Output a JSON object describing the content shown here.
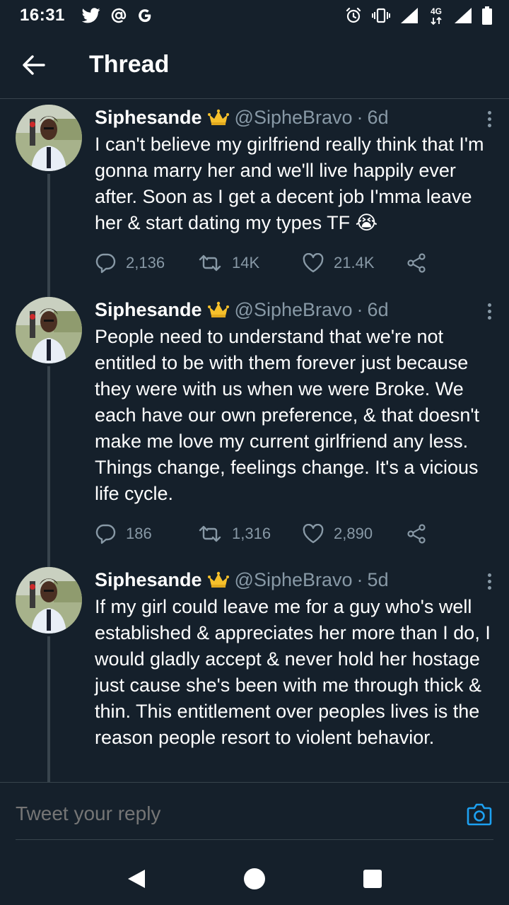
{
  "status_bar": {
    "time": "16:31",
    "left_icons": [
      "twitter-icon",
      "at-icon",
      "google-icon"
    ],
    "right_icons": [
      "alarm-icon",
      "vibrate-icon",
      "signal-icon",
      "4g-icon",
      "signal-icon",
      "battery-icon"
    ],
    "network_label": "4G"
  },
  "header": {
    "title": "Thread"
  },
  "tweets": [
    {
      "name": "Siphesande",
      "badge": "crown-emoji",
      "handle": "@SipheBravo",
      "separator": "·",
      "time": "6d",
      "text": "I can't believe my girlfriend really think that I'm gonna marry her and we'll live happily ever after. Soon as I get a decent job I'mma leave her & start dating my types TF 😭",
      "replies": "2,136",
      "retweets": "14K",
      "likes": "21.4K"
    },
    {
      "name": "Siphesande",
      "badge": "crown-emoji",
      "handle": "@SipheBravo",
      "separator": "·",
      "time": "6d",
      "text": "People need to understand that we're not entitled to be with them forever just because they were with us when we were Broke. We each have our own preference, & that doesn't make me love my current girlfriend any less. Things change, feelings change. It's a vicious life cycle.",
      "replies": "186",
      "retweets": "1,316",
      "likes": "2,890"
    },
    {
      "name": "Siphesande",
      "badge": "crown-emoji",
      "handle": "@SipheBravo",
      "separator": "·",
      "time": "5d",
      "text": "If my girl could leave me for a guy who's well established & appreciates her more than I do, I would gladly accept & never hold her hostage just cause she's been with me through thick & thin. This entitlement over peoples lives is the reason people resort to violent behavior."
    }
  ],
  "composer": {
    "placeholder": "Tweet your reply"
  },
  "colors": {
    "background": "#15202b",
    "divider": "#38444d",
    "secondary_text": "#8899a6",
    "accent": "#1da1f2"
  }
}
